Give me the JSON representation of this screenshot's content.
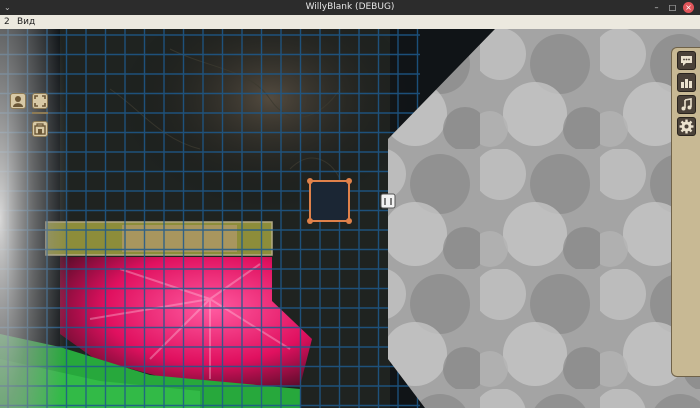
{
  "window": {
    "title": "WillyBlank (DEBUG)"
  },
  "menubar": {
    "number": "2",
    "view_label": "Вид"
  },
  "left_toolbar": [
    {
      "name": "token-tool-button",
      "icon": "person-icon"
    },
    {
      "name": "fullscreen-tool-button",
      "icon": "expand-icon"
    },
    {
      "name": "building-tool-button",
      "icon": "building-icon"
    }
  ],
  "right_panel": [
    {
      "name": "chat-button",
      "icon": "chat-icon"
    },
    {
      "name": "characters-button",
      "icon": "characters-icon"
    },
    {
      "name": "music-button",
      "icon": "music-note-icon"
    },
    {
      "name": "settings-button",
      "icon": "gear-icon"
    }
  ],
  "colors": {
    "grid": "#1e5a8c",
    "fog": "#8a8a8a",
    "selection": "#e0814a",
    "magic_area": "#ff1f78",
    "grass": "#27a83c",
    "panel": "#c8b994"
  }
}
